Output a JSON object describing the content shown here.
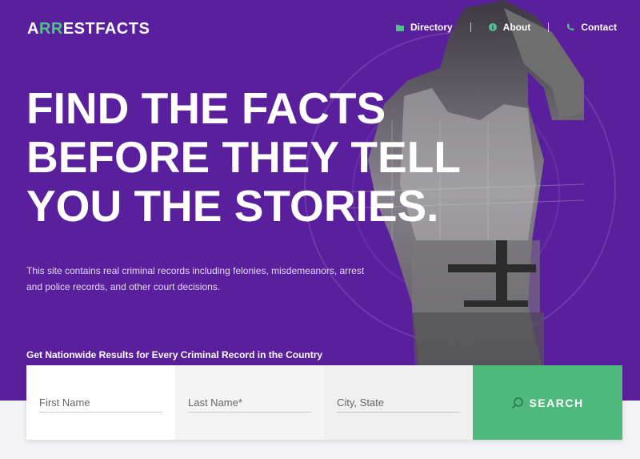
{
  "brand": {
    "logo_text_a": "A",
    "logo_text_rr": "RR",
    "logo_text_rest": "ESTFACTS",
    "accent_color": "#4fc28a",
    "hero_color": "#5a1f9c"
  },
  "nav": {
    "items": [
      {
        "label": "Directory",
        "icon": "folder-icon"
      },
      {
        "label": "About",
        "icon": "info-icon"
      },
      {
        "label": "Contact",
        "icon": "phone-icon"
      }
    ]
  },
  "hero": {
    "headline_lines": [
      "FIND THE FACTS",
      "BEFORE THEY TELL",
      "YOU THE STORIES."
    ],
    "description": "This site contains real criminal records including felonies, misdemeanors, arrest and police records, and other court decisions."
  },
  "search": {
    "label": "Get Nationwide Results for Every Criminal Record in the Country",
    "first_name_placeholder": "First Name",
    "last_name_placeholder": "Last Name*",
    "city_state_placeholder": "City, State",
    "button_label": "SEARCH",
    "button_color": "#4fb87b"
  }
}
